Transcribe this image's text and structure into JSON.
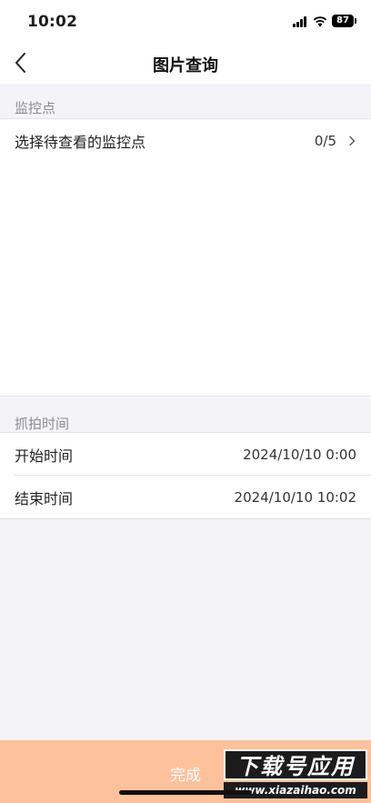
{
  "status": {
    "time": "10:02",
    "battery": "87"
  },
  "nav": {
    "title": "图片查询"
  },
  "monitor": {
    "header": "监控点",
    "select_label": "选择待查看的监控点",
    "select_value": "0/5"
  },
  "capture": {
    "header": "抓拍时间",
    "start_label": "开始时间",
    "start_value": "2024/10/10  0:00",
    "end_label": "结束时间",
    "end_value": "2024/10/10  10:02"
  },
  "footer": {
    "done_label": "完成"
  },
  "watermark": {
    "main": "下载号应用",
    "sub": "www.xiazaihao.com"
  },
  "colors": {
    "accent": "#fdc19b",
    "background": "#f3f3f8"
  }
}
